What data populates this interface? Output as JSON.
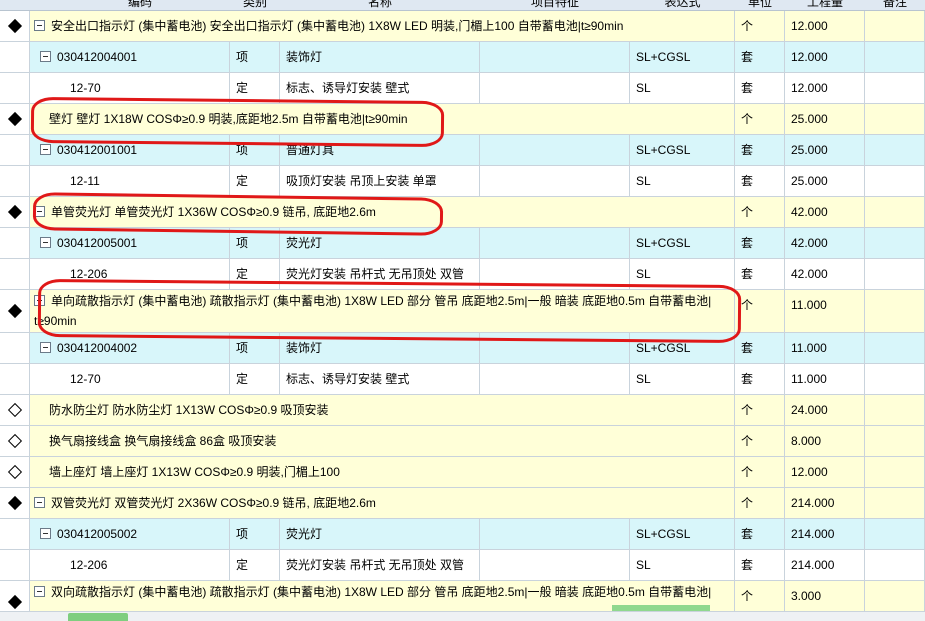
{
  "header": {
    "code": "编码",
    "type": "类别",
    "name": "名称",
    "feature": "项目特征",
    "expression": "表达式",
    "unit": "单位",
    "quantity": "工程量",
    "remark": "备注"
  },
  "rows": [
    {
      "kind": "main",
      "marker": "filled",
      "toggle": true,
      "text": "安全出口指示灯 (集中蓄电池) 安全出口指示灯 (集中蓄电池) 1X8W LED 明装,门楣上100 自带蓄电池|t≥90min",
      "unit": "个",
      "qty": "12.000"
    },
    {
      "kind": "sub",
      "toggle": true,
      "code": "030412004001",
      "type": "项",
      "name": "装饰灯",
      "feature": "",
      "expr": "SL+CGSL",
      "unit": "套",
      "qty": "12.000"
    },
    {
      "kind": "quota",
      "code": "12-70",
      "type": "定",
      "name": "标志、诱导灯安装 壁式",
      "feature": "",
      "expr": "SL",
      "unit": "套",
      "qty": "12.000"
    },
    {
      "kind": "main",
      "marker": "filled",
      "toggle": false,
      "text": "壁灯 壁灯 1X18W COSΦ≥0.9 明装,底距地2.5m 自带蓄电池|t≥90min",
      "unit": "个",
      "qty": "25.000"
    },
    {
      "kind": "sub",
      "toggle": true,
      "code": "030412001001",
      "type": "项",
      "name": "普通灯具",
      "feature": "",
      "expr": "SL+CGSL",
      "unit": "套",
      "qty": "25.000"
    },
    {
      "kind": "quota",
      "code": "12-11",
      "type": "定",
      "name": "吸顶灯安装 吊顶上安装 单罩",
      "feature": "",
      "expr": "SL",
      "unit": "套",
      "qty": "25.000"
    },
    {
      "kind": "main",
      "marker": "filled",
      "toggle": true,
      "text": "单管荧光灯 单管荧光灯 1X36W COSΦ≥0.9 链吊, 底距地2.6m",
      "unit": "个",
      "qty": "42.000"
    },
    {
      "kind": "sub",
      "toggle": true,
      "code": "030412005001",
      "type": "项",
      "name": "荧光灯",
      "feature": "",
      "expr": "SL+CGSL",
      "unit": "套",
      "qty": "42.000"
    },
    {
      "kind": "quota",
      "code": "12-206",
      "type": "定",
      "name": "荧光灯安装 吊杆式 无吊顶处 双管",
      "feature": "",
      "expr": "SL",
      "unit": "套",
      "qty": "42.000"
    },
    {
      "kind": "main",
      "tall": true,
      "marker": "filled",
      "toggle": true,
      "text": "单向疏散指示灯 (集中蓄电池) 疏散指示灯 (集中蓄电池) 1X8W LED 部分 管吊 底距地2.5m|一般 暗装 底距地0.5m 自带蓄电池| t≥90min",
      "unit": "个",
      "qty": "11.000"
    },
    {
      "kind": "sub",
      "toggle": true,
      "code": "030412004002",
      "type": "项",
      "name": "装饰灯",
      "feature": "",
      "expr": "SL+CGSL",
      "unit": "套",
      "qty": "11.000"
    },
    {
      "kind": "quota",
      "code": "12-70",
      "type": "定",
      "name": "标志、诱导灯安装 壁式",
      "feature": "",
      "expr": "SL",
      "unit": "套",
      "qty": "11.000"
    },
    {
      "kind": "main",
      "marker": "hollow",
      "toggle": false,
      "text": "防水防尘灯 防水防尘灯 1X13W COSΦ≥0.9 吸顶安装",
      "unit": "个",
      "qty": "24.000"
    },
    {
      "kind": "main",
      "marker": "hollow",
      "toggle": false,
      "text": "换气扇接线盒 换气扇接线盒 86盒 吸顶安装",
      "unit": "个",
      "qty": "8.000"
    },
    {
      "kind": "main",
      "marker": "hollow",
      "toggle": false,
      "text": "墙上座灯 墙上座灯 1X13W COSΦ≥0.9 明装,门楣上100",
      "unit": "个",
      "qty": "12.000"
    },
    {
      "kind": "main",
      "marker": "filled",
      "toggle": true,
      "text": "双管荧光灯 双管荧光灯 2X36W COSΦ≥0.9 链吊, 底距地2.6m",
      "unit": "个",
      "qty": "214.000"
    },
    {
      "kind": "sub",
      "toggle": true,
      "code": "030412005002",
      "type": "项",
      "name": "荧光灯",
      "feature": "",
      "expr": "SL+CGSL",
      "unit": "套",
      "qty": "214.000"
    },
    {
      "kind": "quota",
      "code": "12-206",
      "type": "定",
      "name": "荧光灯安装 吊杆式 无吊顶处 双管",
      "feature": "",
      "expr": "SL",
      "unit": "套",
      "qty": "214.000"
    },
    {
      "kind": "main",
      "tall": true,
      "marker": "filled",
      "toggle": true,
      "text": "双向疏散指示灯 (集中蓄电池) 疏散指示灯 (集中蓄电池) 1X8W LED 部分 管吊 底距地2.5m|一般 暗装 底距地0.5m 自带蓄电池|",
      "unit": "个",
      "qty": "3.000"
    }
  ],
  "colors": {
    "main_row": "#ffffd8",
    "sub_row": "#d8f6fa",
    "quota_row": "#ffffff",
    "annotation": "#e01818"
  },
  "icons": {
    "filled_marker": "filled-diamond-icon",
    "hollow_marker": "hollow-diamond-icon",
    "toggle": "collapse-minus-icon"
  }
}
